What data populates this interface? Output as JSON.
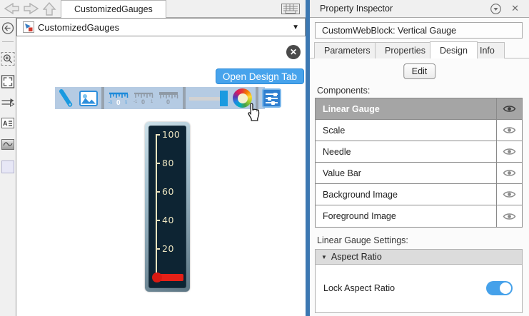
{
  "top_nav": {
    "doc_tab": "CustomizedGauges"
  },
  "canvas": {
    "breadcrumb": "CustomizedGauges",
    "tooltip": "Open Design Tab"
  },
  "gauge": {
    "ticks": [
      "100",
      "80",
      "60",
      "40",
      "20"
    ]
  },
  "inspector": {
    "title": "Property Inspector",
    "block_label": "CustomWebBlock: Vertical Gauge",
    "tabs": [
      {
        "label": "Parameters",
        "active": false
      },
      {
        "label": "Properties",
        "active": false
      },
      {
        "label": "Design",
        "active": true
      },
      {
        "label": "Info",
        "active": false
      }
    ],
    "edit_button": "Edit",
    "components_label": "Components:",
    "components": [
      {
        "label": "Linear Gauge",
        "selected": true
      },
      {
        "label": "Scale",
        "selected": false
      },
      {
        "label": "Needle",
        "selected": false
      },
      {
        "label": "Value Bar",
        "selected": false
      },
      {
        "label": "Background Image",
        "selected": false
      },
      {
        "label": "Foreground Image",
        "selected": false
      }
    ],
    "settings_label": "Linear Gauge Settings:",
    "aspect_section": {
      "label": "Aspect Ratio",
      "expanded": true
    },
    "lock_row": {
      "label": "Lock Aspect Ratio",
      "on": true
    }
  },
  "icons": {
    "close_x": "✕",
    "caret_down": "▼",
    "section_caret": "▼"
  },
  "colors": {
    "accent_blue": "#2e8fdc",
    "tooltip_bg": "#47a3ec",
    "toolbar_bg": "#b5cbe3",
    "gauge_face": "#0d2433",
    "scale_cream": "#ece5c0",
    "needle_red": "#e52017",
    "selected_row": "#a5a5a5",
    "toggle_on": "#45a1ea",
    "panel_divider": "#3c78b2"
  }
}
